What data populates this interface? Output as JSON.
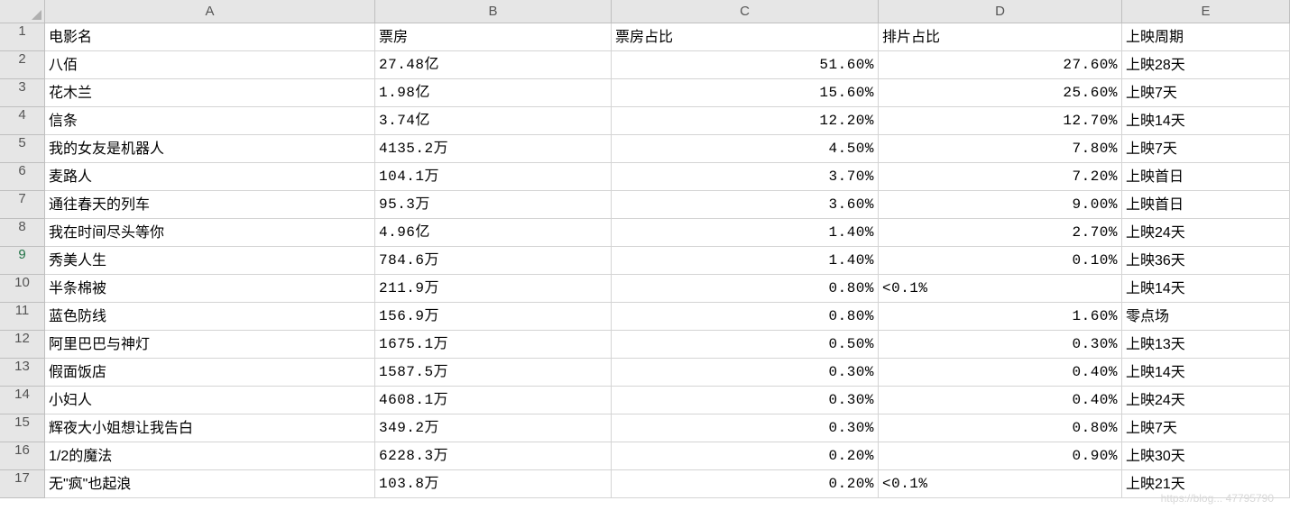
{
  "columns": [
    "A",
    "B",
    "C",
    "D",
    "E"
  ],
  "selectedRow": 9,
  "headerRow": {
    "A": "电影名",
    "B": "票房",
    "C": "票房占比",
    "D": "排片占比",
    "E": "上映周期"
  },
  "rows": [
    {
      "n": 1,
      "A": "电影名",
      "B": "票房",
      "C": "票房占比",
      "D": "排片占比",
      "E": "上映周期",
      "cAlign": "left",
      "dAlign": "left"
    },
    {
      "n": 2,
      "A": "八佰",
      "B": "27.48亿",
      "C": "51.60%",
      "D": "27.60%",
      "E": "上映28天",
      "cAlign": "right",
      "dAlign": "right"
    },
    {
      "n": 3,
      "A": "花木兰",
      "B": "1.98亿",
      "C": "15.60%",
      "D": "25.60%",
      "E": "上映7天",
      "cAlign": "right",
      "dAlign": "right"
    },
    {
      "n": 4,
      "A": "信条",
      "B": "3.74亿",
      "C": "12.20%",
      "D": "12.70%",
      "E": "上映14天",
      "cAlign": "right",
      "dAlign": "right"
    },
    {
      "n": 5,
      "A": "我的女友是机器人",
      "B": "4135.2万",
      "C": "4.50%",
      "D": "7.80%",
      "E": "上映7天",
      "cAlign": "right",
      "dAlign": "right"
    },
    {
      "n": 6,
      "A": "麦路人",
      "B": "104.1万",
      "C": "3.70%",
      "D": "7.20%",
      "E": "上映首日",
      "cAlign": "right",
      "dAlign": "right"
    },
    {
      "n": 7,
      "A": "通往春天的列车",
      "B": "95.3万",
      "C": "3.60%",
      "D": "9.00%",
      "E": "上映首日",
      "cAlign": "right",
      "dAlign": "right"
    },
    {
      "n": 8,
      "A": "我在时间尽头等你",
      "B": "4.96亿",
      "C": "1.40%",
      "D": "2.70%",
      "E": "上映24天",
      "cAlign": "right",
      "dAlign": "right"
    },
    {
      "n": 9,
      "A": "秀美人生",
      "B": "784.6万",
      "C": "1.40%",
      "D": "0.10%",
      "E": "上映36天",
      "cAlign": "right",
      "dAlign": "right"
    },
    {
      "n": 10,
      "A": "半条棉被",
      "B": "211.9万",
      "C": "0.80%",
      "D": "<0.1%",
      "E": "上映14天",
      "cAlign": "right",
      "dAlign": "left"
    },
    {
      "n": 11,
      "A": "蓝色防线",
      "B": "156.9万",
      "C": "0.80%",
      "D": "1.60%",
      "E": "零点场",
      "cAlign": "right",
      "dAlign": "right"
    },
    {
      "n": 12,
      "A": "阿里巴巴与神灯",
      "B": "1675.1万",
      "C": "0.50%",
      "D": "0.30%",
      "E": "上映13天",
      "cAlign": "right",
      "dAlign": "right"
    },
    {
      "n": 13,
      "A": "假面饭店",
      "B": "1587.5万",
      "C": "0.30%",
      "D": "0.40%",
      "E": "上映14天",
      "cAlign": "right",
      "dAlign": "right"
    },
    {
      "n": 14,
      "A": "小妇人",
      "B": "4608.1万",
      "C": "0.30%",
      "D": "0.40%",
      "E": "上映24天",
      "cAlign": "right",
      "dAlign": "right"
    },
    {
      "n": 15,
      "A": "辉夜大小姐想让我告白",
      "B": "349.2万",
      "C": "0.30%",
      "D": "0.80%",
      "E": "上映7天",
      "cAlign": "right",
      "dAlign": "right"
    },
    {
      "n": 16,
      "A": "1/2的魔法",
      "B": "6228.3万",
      "C": "0.20%",
      "D": "0.90%",
      "E": "上映30天",
      "cAlign": "right",
      "dAlign": "right"
    },
    {
      "n": 17,
      "A": "无\"疯\"也起浪",
      "B": "103.8万",
      "C": "0.20%",
      "D": "<0.1%",
      "E": "上映21天",
      "cAlign": "right",
      "dAlign": "left"
    }
  ],
  "watermark": "https://blog... 47795790"
}
